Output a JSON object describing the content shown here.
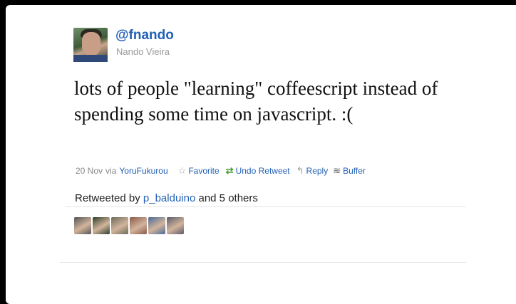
{
  "tweet": {
    "screen_name": "@fnando",
    "full_name": "Nando Vieira",
    "text": "lots of people \"learning\" coffeescript instead of spending some time on javascript. :(",
    "date": "20 Nov",
    "via_label": "via",
    "source": "YoruFukurou"
  },
  "actions": {
    "favorite": "Favorite",
    "undo_retweet": "Undo Retweet",
    "reply": "Reply",
    "buffer": "Buffer"
  },
  "icons": {
    "favorite": "star-icon",
    "retweet": "retweet-icon",
    "reply": "reply-icon",
    "buffer": "buffer-icon"
  },
  "retweets": {
    "prefix": "Retweeted by",
    "user": "p_balduino",
    "suffix": "and 5 others",
    "avatar_colors": [
      "#555555",
      "#2f3f2a",
      "#6b6b5a",
      "#8a5a4a",
      "#4a6a9a",
      "#5a5a6a"
    ]
  }
}
